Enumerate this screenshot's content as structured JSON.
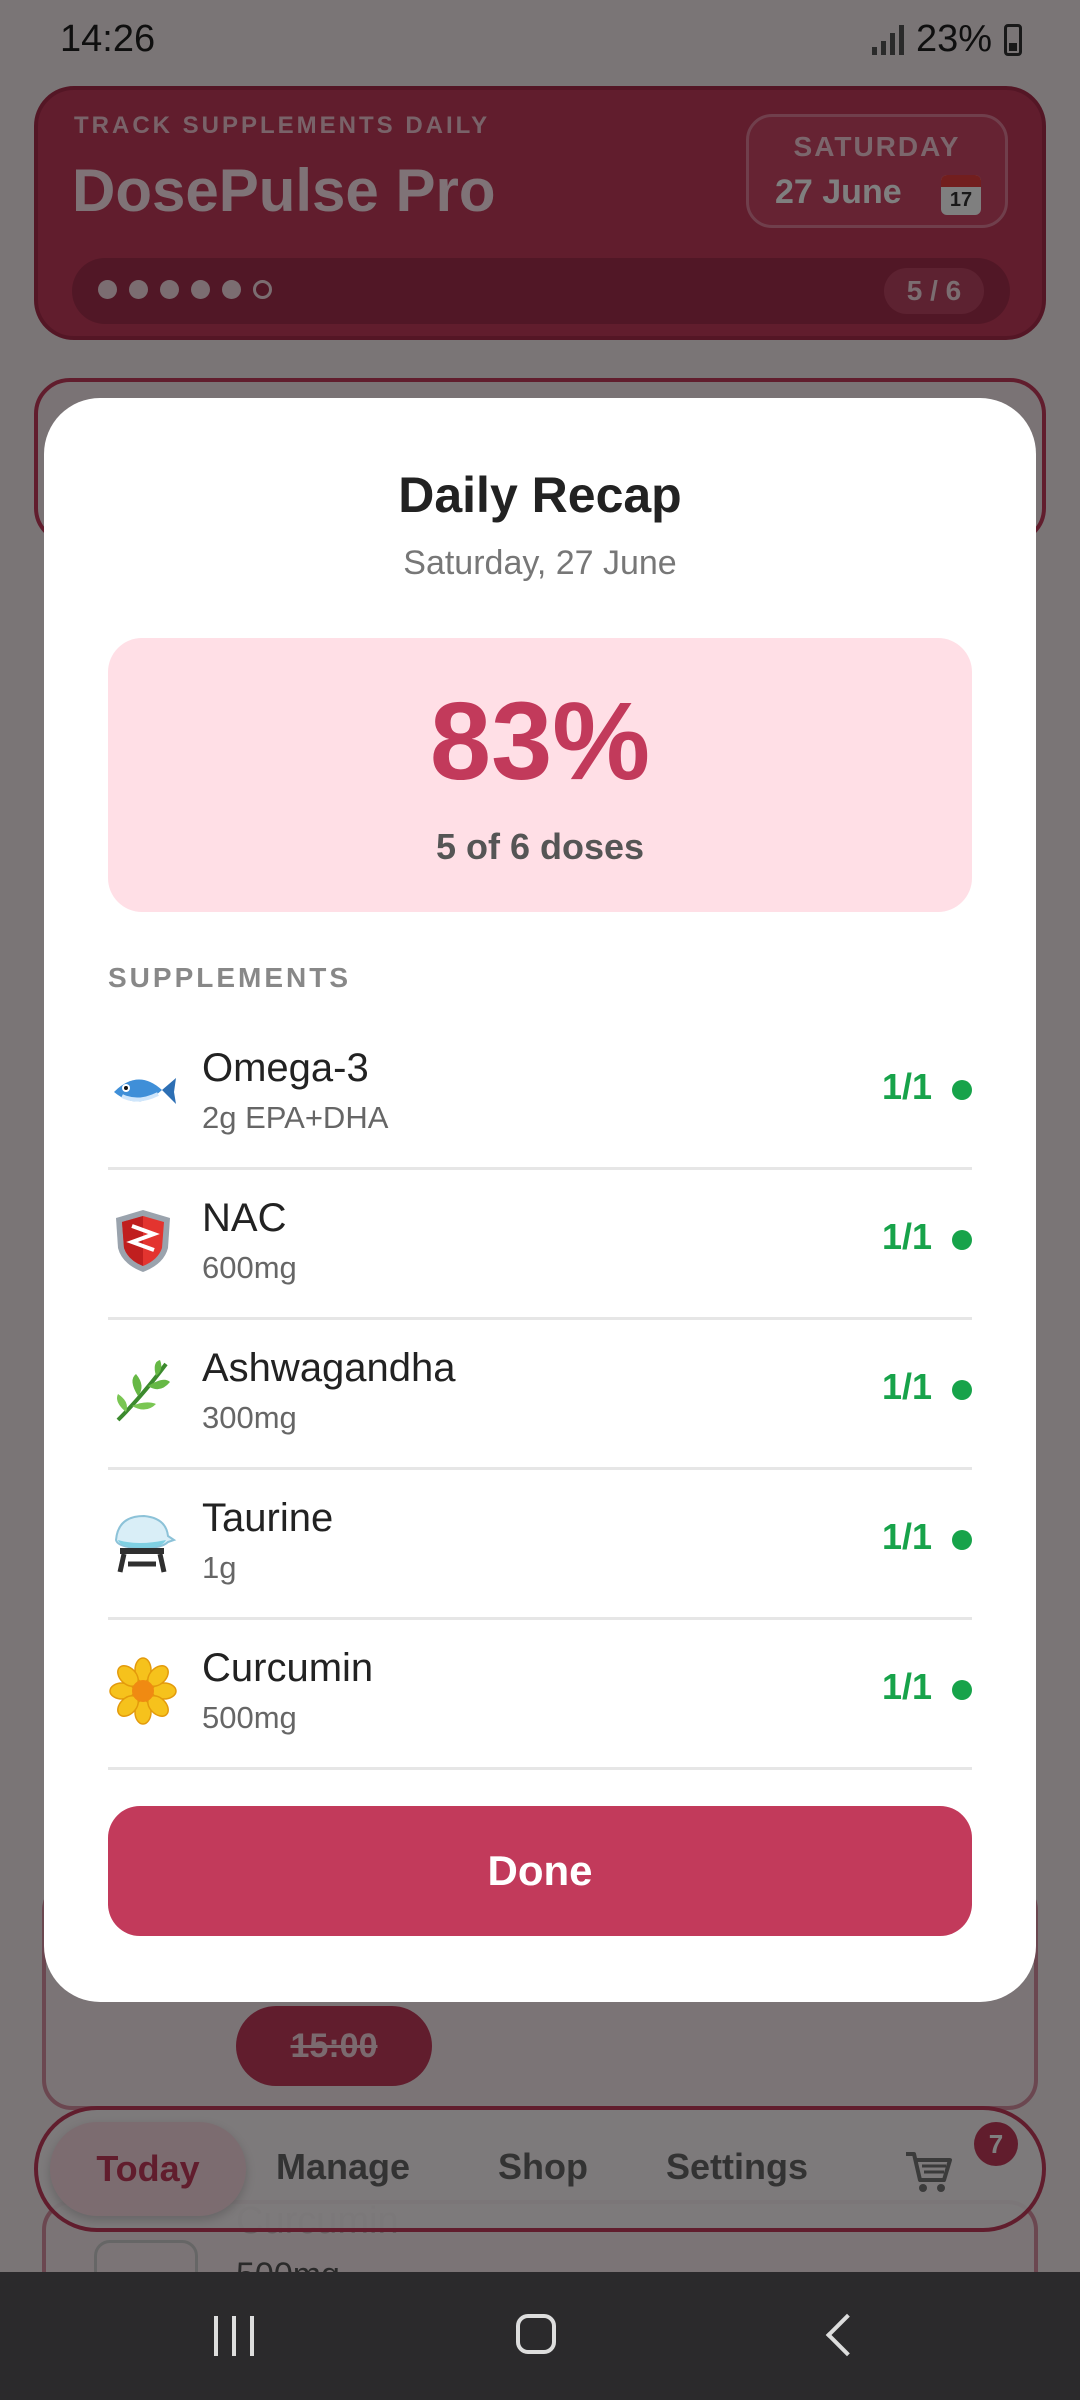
{
  "status_bar": {
    "time": "14:26",
    "battery": "23%"
  },
  "header": {
    "tagline": "TRACK SUPPLEMENTS DAILY",
    "app_title": "DosePulse Pro",
    "date_day": "SATURDAY",
    "date_text": "27 June",
    "calendar_day": "17",
    "progress_count": "5 / 6",
    "progress_taken": 5,
    "progress_total": 6
  },
  "background": {
    "partial_time": "15:00",
    "partial_name": "Curcumin",
    "partial_dose": "500mg"
  },
  "bottom_nav": {
    "items": [
      "Today",
      "Manage",
      "Shop",
      "Settings"
    ],
    "active": "Today",
    "cart_badge": "7"
  },
  "modal": {
    "title": "Daily Recap",
    "subtitle": "Saturday, 27 June",
    "percent": "83%",
    "doses_summary": "5 of 6 doses",
    "section_label": "SUPPLEMENTS",
    "supplements": [
      {
        "name": "Omega-3",
        "dose": "2g EPA+DHA",
        "status": "1/1",
        "icon": "fish-icon"
      },
      {
        "name": "NAC",
        "dose": "600mg",
        "status": "1/1",
        "icon": "shield-icon"
      },
      {
        "name": "Ashwagandha",
        "dose": "300mg",
        "status": "1/1",
        "icon": "herb-icon"
      },
      {
        "name": "Taurine",
        "dose": "1g",
        "status": "1/1",
        "icon": "flask-icon"
      },
      {
        "name": "Curcumin",
        "dose": "500mg",
        "status": "1/1",
        "icon": "flower-icon"
      }
    ],
    "done_label": "Done"
  },
  "colors": {
    "accent": "#c23a5b",
    "success": "#17a34a",
    "pct_card_bg": "#ffdfe6"
  }
}
